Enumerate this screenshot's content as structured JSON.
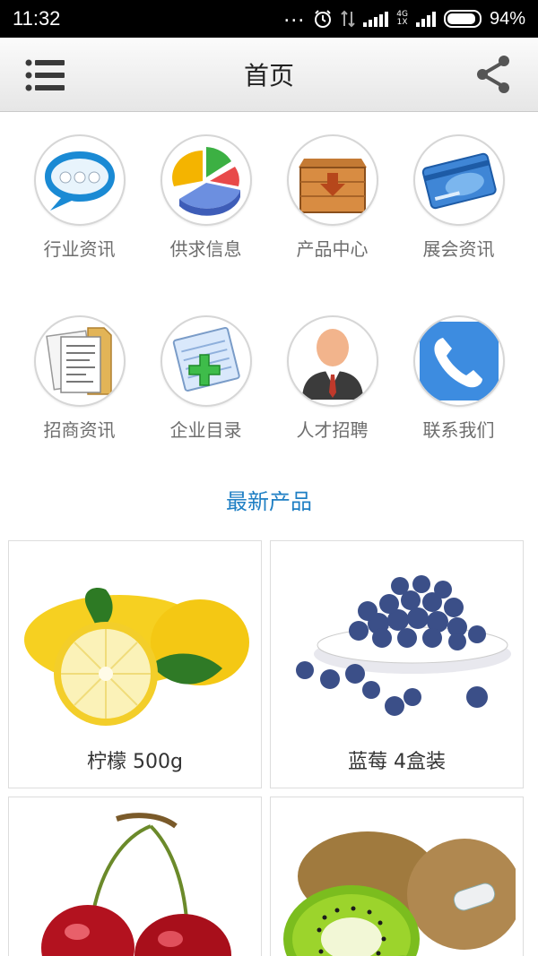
{
  "status_bar": {
    "time": "11:32",
    "dots": "...",
    "network_top": "4G",
    "network_bottom": "1X",
    "battery": "94%"
  },
  "header": {
    "title": "首页"
  },
  "grid": [
    {
      "label": "行业资讯",
      "icon": "chat-bubble-icon"
    },
    {
      "label": "供求信息",
      "icon": "pie-chart-icon"
    },
    {
      "label": "产品中心",
      "icon": "box-icon"
    },
    {
      "label": "展会资讯",
      "icon": "card-icon"
    },
    {
      "label": "招商资讯",
      "icon": "documents-icon"
    },
    {
      "label": "企业目录",
      "icon": "notepad-add-icon"
    },
    {
      "label": "人才招聘",
      "icon": "person-icon"
    },
    {
      "label": "联系我们",
      "icon": "phone-icon"
    }
  ],
  "section_title": "最新产品",
  "products": [
    {
      "name": "柠檬 500g",
      "image": "lemon"
    },
    {
      "name": "蓝莓 4盒装",
      "image": "blueberries"
    },
    {
      "name": "",
      "image": "cherries"
    },
    {
      "name": "",
      "image": "kiwi"
    }
  ],
  "colors": {
    "accent": "#1f7fc4",
    "label": "#6d6d6d",
    "status_bar": "#000000"
  }
}
